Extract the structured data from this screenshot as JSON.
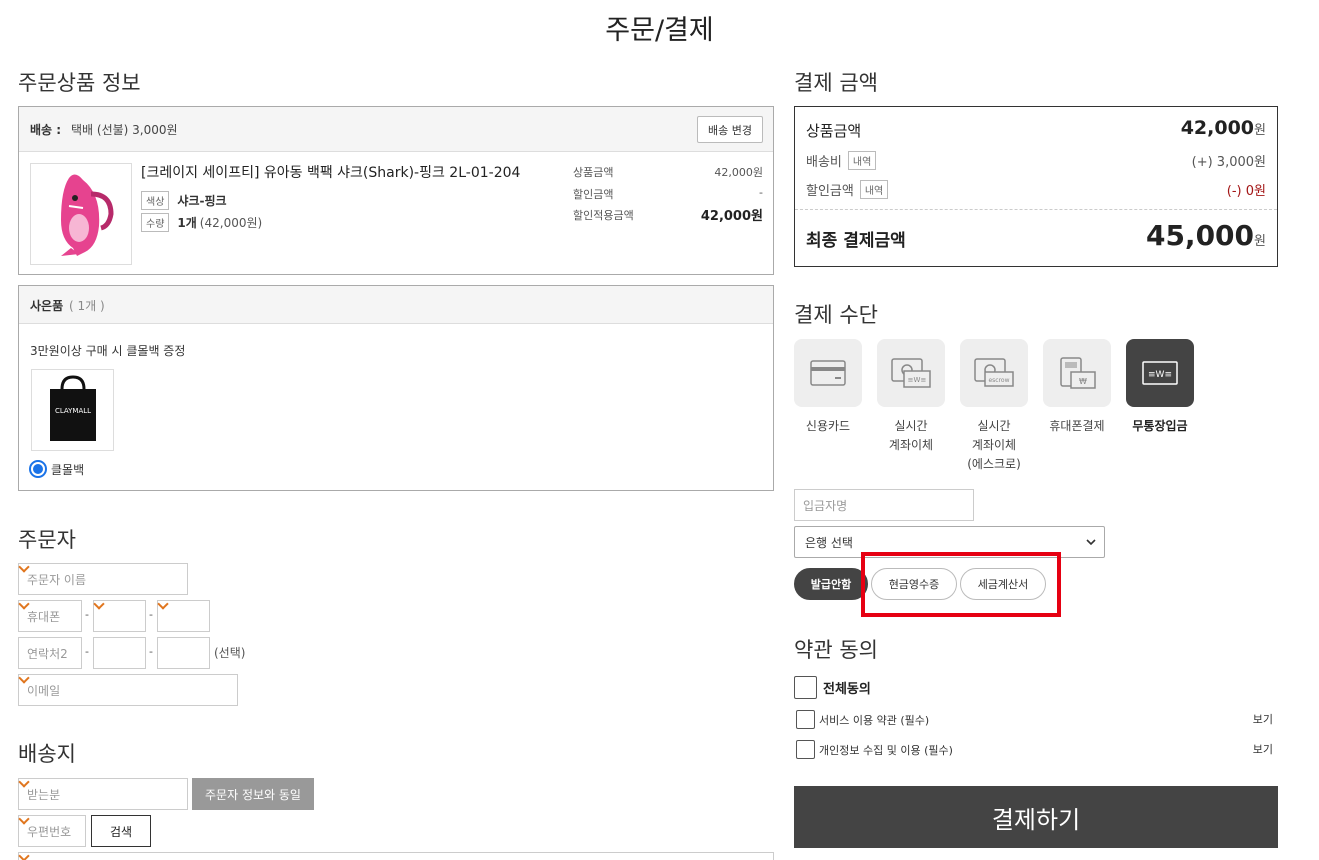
{
  "page_title": "주문/결제",
  "order_items": {
    "heading": "주문상품 정보",
    "shipping_label": "배송 :",
    "shipping_value": "택배 (선불) 3,000원",
    "change_shipping_button": "배송 변경",
    "product_name": "[크레이지 세이프티] 유아동 백팩 샤크(Shark)-핑크 2L-01-204",
    "color_tag": "색상",
    "color_value": "샤크-핑크",
    "qty_tag": "수량",
    "qty_value": "1개",
    "qty_price": "(42,000원)",
    "price_label": "상품금액",
    "price_value": "42,000원",
    "discount_label": "할인금액",
    "discount_value": "-",
    "discounted_label": "할인적용금액",
    "discounted_value": "42,000원"
  },
  "gift": {
    "title": "사은품",
    "count": "( 1개 )",
    "description": "3만원이상 구매 시 클몰백 증정",
    "bag_text": "CLAYMALL",
    "option_label": "클몰백"
  },
  "orderer": {
    "heading": "주문자",
    "name_placeholder": "주문자 이름",
    "phone_placeholder": "휴대폰",
    "contact2_placeholder": "연락처2",
    "optional_label": "(선택)",
    "email_placeholder": "이메일",
    "dash": "-"
  },
  "delivery": {
    "heading": "배송지",
    "receiver_placeholder": "받는분",
    "same_as_orderer_button": "주문자 정보와 동일",
    "zipcode_placeholder": "우편번호",
    "search_button": "검색"
  },
  "payment_amount": {
    "heading": "결제 금액",
    "product_label": "상품금액",
    "product_value": "42,000",
    "won": "원",
    "shipping_label": "배송비",
    "shipping_detail": "내역",
    "shipping_value": "(+) 3,000원",
    "discount_label": "할인금액",
    "discount_detail": "내역",
    "discount_value": "(-) 0원",
    "final_label": "최종 결제금액",
    "final_value": "45,000"
  },
  "payment_method": {
    "heading": "결제 수단",
    "methods": [
      {
        "label": "신용카드"
      },
      {
        "label": "실시간\n계좌이체"
      },
      {
        "label": "실시간\n계좌이체\n(에스크로)"
      },
      {
        "label": "휴대폰결제"
      },
      {
        "label": "무통장입금"
      }
    ],
    "escrow_icon_text": "escrow",
    "depositor_placeholder": "입금자명",
    "bank_select": "은행 선택",
    "receipt_options": [
      "발급안함",
      "현금영수증",
      "세금계산서"
    ]
  },
  "terms": {
    "heading": "약관 동의",
    "agree_all": "전체동의",
    "items": [
      {
        "label": "서비스 이용 약관 (필수)",
        "view": "보기"
      },
      {
        "label": "개인정보 수집 및 이용 (필수)",
        "view": "보기"
      }
    ]
  },
  "pay_button": "결제하기",
  "colors": {
    "highlight": "#e60012",
    "dark": "#444444",
    "discount_red": "#a31515",
    "required_mark": "#e0761f"
  }
}
